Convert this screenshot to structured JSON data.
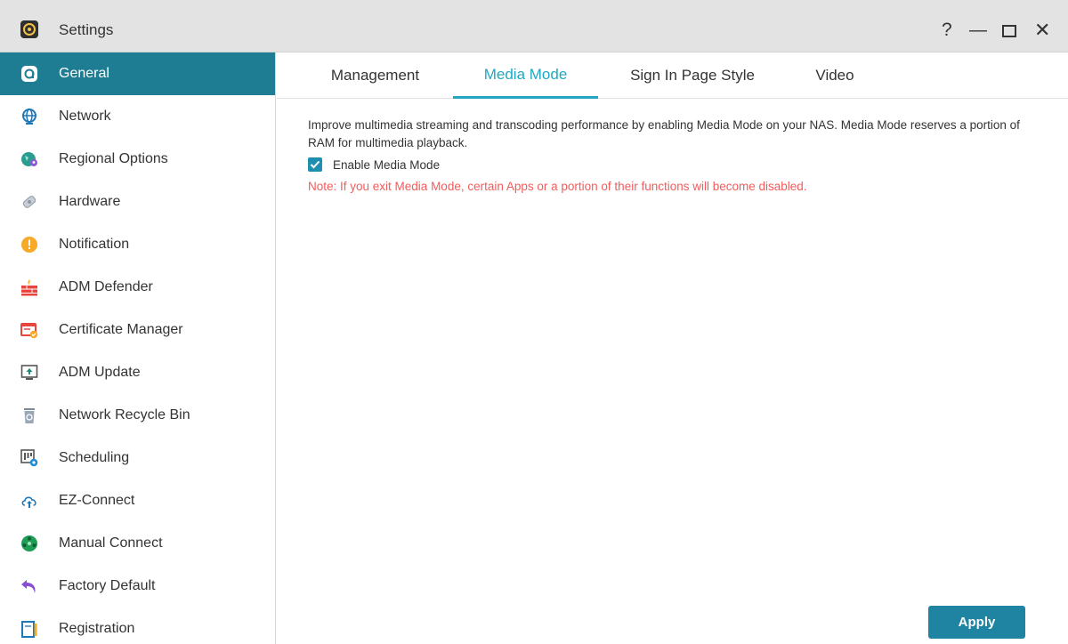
{
  "window": {
    "title": "Settings",
    "controls": {
      "help": "?",
      "minimize": "—",
      "close": "✕"
    }
  },
  "sidebar": {
    "items": [
      {
        "label": "General",
        "icon": "general-icon",
        "active": true
      },
      {
        "label": "Network",
        "icon": "globe-icon"
      },
      {
        "label": "Regional Options",
        "icon": "globe-pin-icon"
      },
      {
        "label": "Hardware",
        "icon": "hardware-icon"
      },
      {
        "label": "Notification",
        "icon": "exclamation-icon"
      },
      {
        "label": "ADM Defender",
        "icon": "firewall-icon"
      },
      {
        "label": "Certificate Manager",
        "icon": "certificate-icon"
      },
      {
        "label": "ADM Update",
        "icon": "update-icon"
      },
      {
        "label": "Network Recycle Bin",
        "icon": "recycle-bin-icon"
      },
      {
        "label": "Scheduling",
        "icon": "scheduling-icon"
      },
      {
        "label": "EZ-Connect",
        "icon": "cloud-upload-icon"
      },
      {
        "label": "Manual Connect",
        "icon": "manual-connect-icon"
      },
      {
        "label": "Factory Default",
        "icon": "undo-arrow-icon"
      },
      {
        "label": "Registration",
        "icon": "registration-icon"
      }
    ]
  },
  "tabs": [
    {
      "label": "Management"
    },
    {
      "label": "Media Mode",
      "active": true
    },
    {
      "label": "Sign In Page Style"
    },
    {
      "label": "Video"
    }
  ],
  "content": {
    "description": "Improve multimedia streaming and transcoding performance by enabling Media Mode on your NAS. Media Mode reserves a portion of RAM for multimedia playback.",
    "checkbox_label": "Enable Media Mode",
    "checkbox_checked": true,
    "note": "Note: If you exit Media Mode, certain Apps or a portion of their functions will become disabled."
  },
  "buttons": {
    "apply": "Apply"
  },
  "colors": {
    "accent": "#1e7c93",
    "tab_active": "#1fa8c0",
    "note": "#f25c5c",
    "button": "#1f84a2"
  }
}
